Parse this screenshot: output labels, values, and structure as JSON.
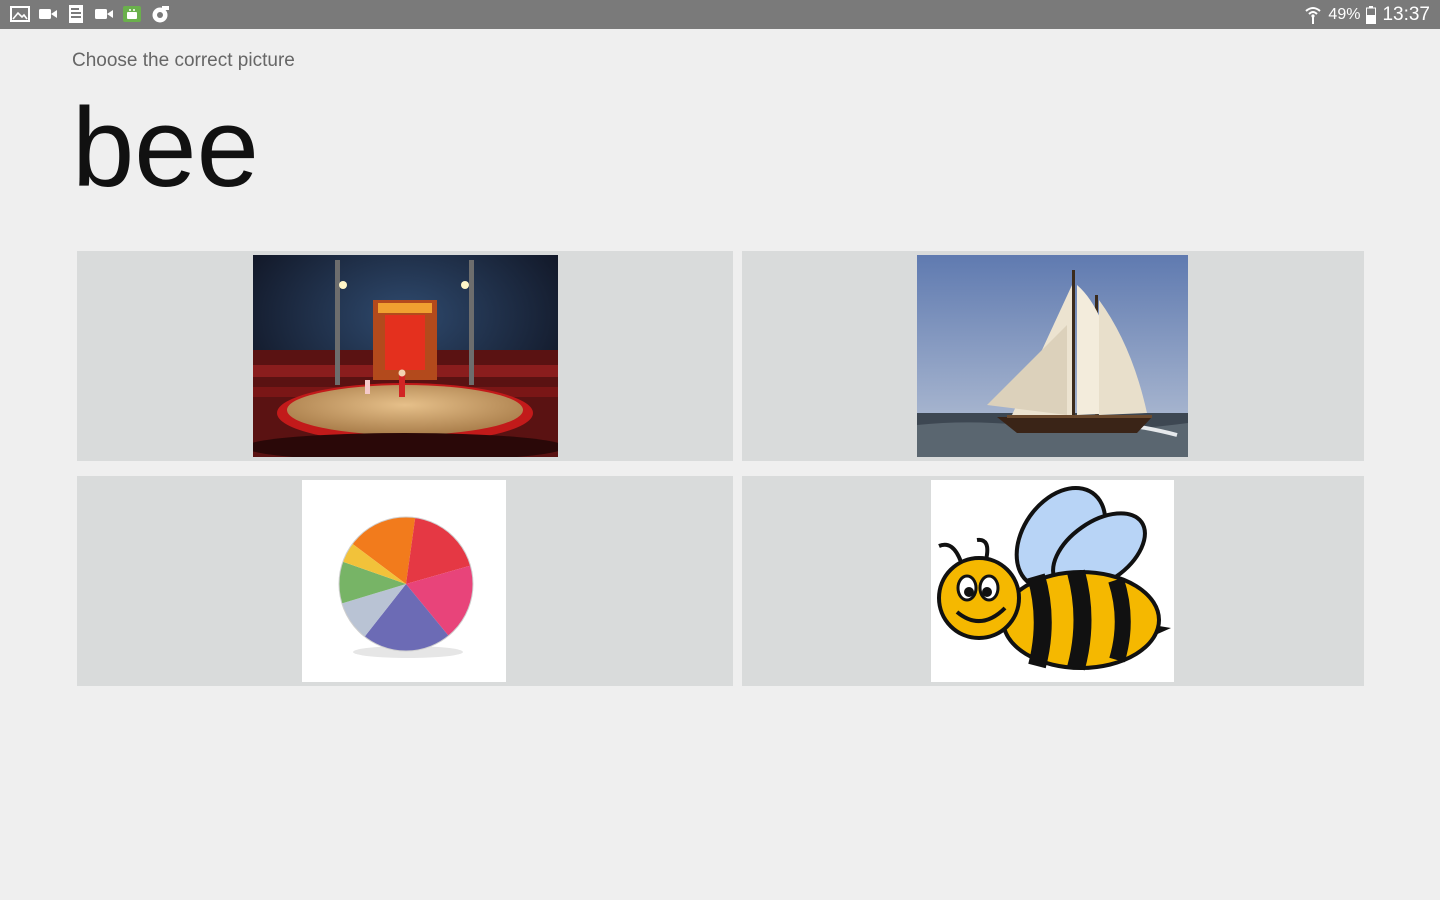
{
  "status_bar": {
    "battery_percent": "49%",
    "time": "13:37",
    "notification_icons": [
      "gallery-icon",
      "video-icon",
      "document-icon",
      "video-icon",
      "android-app-icon",
      "camera-app-icon"
    ],
    "right_icons": [
      "wifi-icon",
      "battery-icon"
    ]
  },
  "quiz": {
    "instruction": "Choose the correct picture",
    "word": "bee"
  },
  "choices": [
    {
      "picture": "circus-ring-picture"
    },
    {
      "picture": "sailboat-picture"
    },
    {
      "picture": "beach-ball-picture"
    },
    {
      "picture": "bee-picture"
    }
  ],
  "colors": {
    "status_bar": "#7a7a7a",
    "background": "#efefef",
    "tile": "#d9dbdb",
    "word": "#111111",
    "instruction": "#666666"
  }
}
